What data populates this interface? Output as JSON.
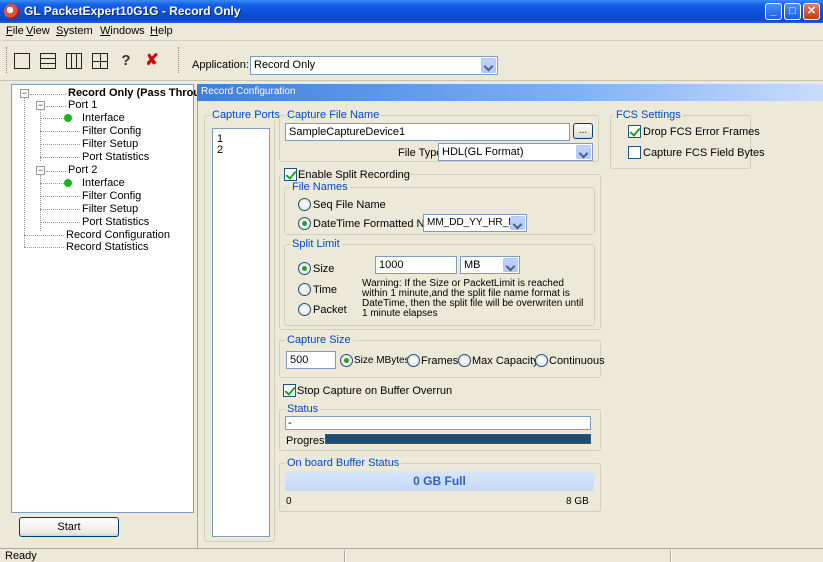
{
  "window": {
    "title": "GL PacketExpert10G1G - Record Only"
  },
  "menu": [
    {
      "label": "File",
      "ul": "F",
      "rest": "ile"
    },
    {
      "label": "View",
      "ul": "V",
      "rest": "iew"
    },
    {
      "label": "System",
      "ul": "S",
      "rest": "ystem"
    },
    {
      "label": "Windows",
      "ul": "W",
      "rest": "indows"
    },
    {
      "label": "Help",
      "ul": "H",
      "rest": "elp"
    }
  ],
  "toolbar": {
    "application_label": "Application:",
    "application_value": "Record Only",
    "icons": [
      "single-pane-icon",
      "horizontal-split-icon",
      "vertical-split-icon",
      "quad-split-icon",
      "help-icon",
      "close-icon"
    ]
  },
  "tree": {
    "root": "Record Only (Pass Through)",
    "port1": "Port 1",
    "port1_items": [
      "Interface",
      "Filter Config",
      "Filter Setup",
      "Port Statistics"
    ],
    "port2": "Port 2",
    "port2_items": [
      "Interface",
      "Filter Config",
      "Filter Setup",
      "Port Statistics"
    ],
    "record_configuration": "Record Configuration",
    "record_statistics": "Record Statistics"
  },
  "start_button": "Start",
  "main": {
    "header": "Record Configuration",
    "capture_ports": {
      "title": "Capture Ports",
      "items": [
        "1",
        "2"
      ]
    },
    "capture_file": {
      "title": "Capture File Name",
      "value": "SampleCaptureDevice1",
      "browse": "...",
      "file_type_label": "File Type",
      "file_type_value": "HDL(GL Format)"
    },
    "fcs": {
      "title": "FCS Settings",
      "drop_errors": "Drop FCS Error Frames",
      "capture_bytes": "Capture FCS Field Bytes"
    },
    "split": {
      "enable_label": "Enable Split Recording",
      "file_names_title": "File Names",
      "seq_name": "Seq File Name",
      "datetime_name": "DateTime Formatted Names",
      "datetime_format": "MM_DD_YY_HR_MM",
      "limit_title": "Split Limit",
      "size": "Size",
      "time": "Time",
      "packet": "Packet",
      "size_value": "1000",
      "size_unit": "MB",
      "warning": "Warning: If the Size or PacketLimit is reached within 1 minute,and the split file name format is DateTime, then the split file will be overwriten until 1 minute elapses"
    },
    "capture_size": {
      "title": "Capture Size",
      "value": "500",
      "size_mbytes": "Size MBytes",
      "frames": "Frames",
      "max_capacity": "Max Capacity",
      "continuous": "Continuous"
    },
    "stop_overrun": "Stop Capture on Buffer Overrun",
    "status": {
      "title": "Status",
      "value": "-",
      "progress_label": "Progress",
      "progress_fraction": 1.0
    },
    "buffer": {
      "title": "On board Buffer Status",
      "value": "0 GB Full",
      "min": "0",
      "max": "8 GB"
    }
  },
  "statusbar": {
    "text": "Ready"
  },
  "colors": {
    "title_bar": "#0a4fd8",
    "group_title": "#0046d5",
    "progress": "#1e4d73",
    "tree_bullet": "#1bb31b"
  }
}
